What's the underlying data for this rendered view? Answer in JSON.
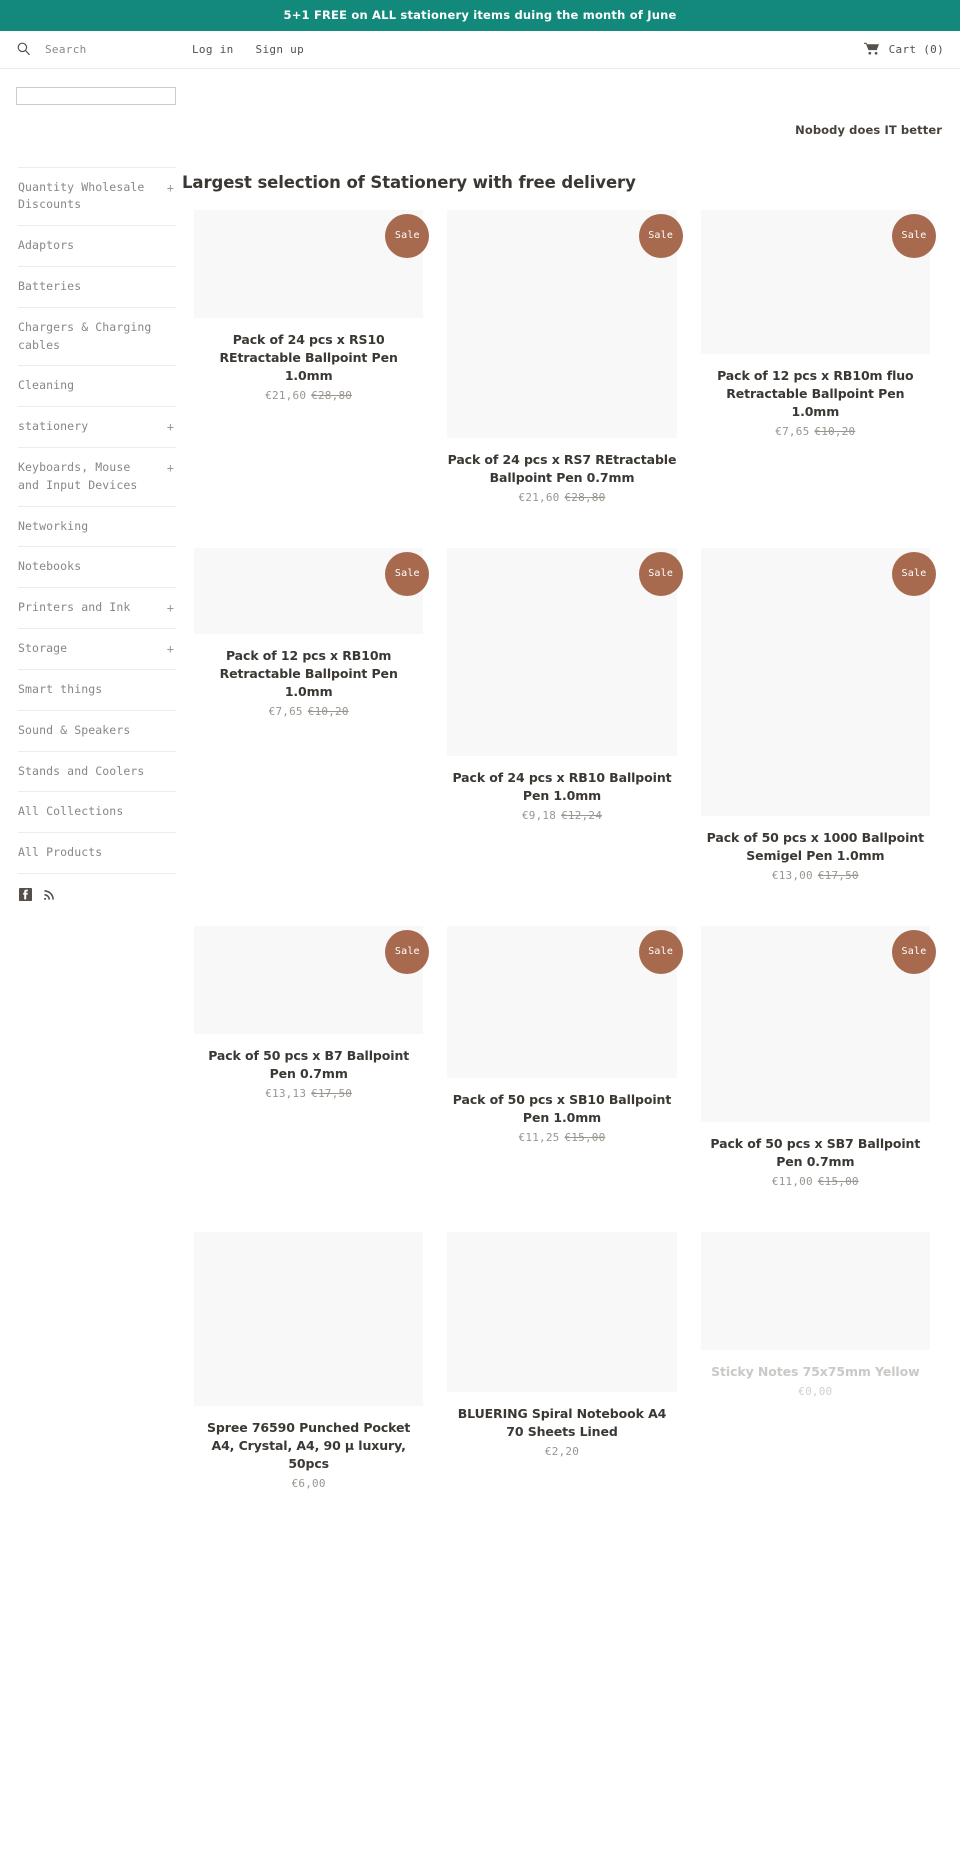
{
  "announcement": {
    "text": "5+1 FREE on ALL stationery items duing the month of June"
  },
  "topbar": {
    "search_icon": "search-icon",
    "search_label": "Search",
    "login_label": "Log in",
    "signup_label": "Sign up",
    "cart_icon": "shopping-cart-icon",
    "cart_label": "Cart (0)"
  },
  "search": {
    "value": "",
    "placeholder": ""
  },
  "tagline": "Nobody does IT better",
  "sidebar": {
    "items": [
      {
        "label": "Quantity Wholesale Discounts",
        "expandable": true,
        "plus": "+"
      },
      {
        "label": "Adaptors",
        "expandable": false,
        "plus": ""
      },
      {
        "label": "Batteries",
        "expandable": false,
        "plus": ""
      },
      {
        "label": "Chargers & Charging cables",
        "expandable": false,
        "plus": ""
      },
      {
        "label": "Cleaning",
        "expandable": false,
        "plus": ""
      },
      {
        "label": "stationery",
        "expandable": true,
        "plus": "+"
      },
      {
        "label": "Keyboards, Mouse and Input Devices",
        "expandable": true,
        "plus": "+"
      },
      {
        "label": "Networking",
        "expandable": false,
        "plus": ""
      },
      {
        "label": "Notebooks",
        "expandable": false,
        "plus": ""
      },
      {
        "label": "Printers and Ink",
        "expandable": true,
        "plus": "+"
      },
      {
        "label": "Storage",
        "expandable": true,
        "plus": "+"
      },
      {
        "label": "Smart things",
        "expandable": false,
        "plus": ""
      },
      {
        "label": "Sound & Speakers",
        "expandable": false,
        "plus": ""
      },
      {
        "label": "Stands and Coolers",
        "expandable": false,
        "plus": ""
      },
      {
        "label": "All Collections",
        "expandable": false,
        "plus": ""
      },
      {
        "label": "All Products",
        "expandable": false,
        "plus": ""
      }
    ],
    "social": [
      {
        "icon": "facebook-icon"
      },
      {
        "icon": "rss-icon"
      }
    ]
  },
  "main": {
    "page_title": "Largest selection of Stationery with free delivery",
    "sale_badge_label": "Sale",
    "products": [
      {
        "title": "Pack of 24 pcs x RS10 REtractable Ballpoint Pen 1.0mm",
        "price": "€21,60",
        "compare_price": "€28,80",
        "on_sale": true,
        "thumb_height": 108,
        "faded": false
      },
      {
        "title": "Pack of 24 pcs x RS7 REtractable Ballpoint Pen 0.7mm",
        "price": "€21,60",
        "compare_price": "€28,80",
        "on_sale": true,
        "thumb_height": 228,
        "faded": false
      },
      {
        "title": "Pack of 12 pcs x RB10m fluo Retractable Ballpoint Pen 1.0mm",
        "price": "€7,65",
        "compare_price": "€10,20",
        "on_sale": true,
        "thumb_height": 144,
        "faded": false
      },
      {
        "title": "Pack of 12 pcs x RB10m Retractable Ballpoint Pen 1.0mm",
        "price": "€7,65",
        "compare_price": "€10,20",
        "on_sale": true,
        "thumb_height": 86,
        "faded": false
      },
      {
        "title": "Pack of 24 pcs x RB10 Ballpoint Pen 1.0mm",
        "price": "€9,18",
        "compare_price": "€12,24",
        "on_sale": true,
        "thumb_height": 208,
        "faded": false
      },
      {
        "title": "Pack of 50 pcs x 1000 Ballpoint Semigel Pen 1.0mm",
        "price": "€13,00",
        "compare_price": "€17,50",
        "on_sale": true,
        "thumb_height": 268,
        "faded": false
      },
      {
        "title": "Pack of 50 pcs x B7 Ballpoint Pen 0.7mm",
        "price": "€13,13",
        "compare_price": "€17,50",
        "on_sale": true,
        "thumb_height": 108,
        "faded": false
      },
      {
        "title": "Pack of 50 pcs x SB10 Ballpoint Pen 1.0mm",
        "price": "€11,25",
        "compare_price": "€15,00",
        "on_sale": true,
        "thumb_height": 152,
        "faded": false
      },
      {
        "title": "Pack of 50 pcs x SB7 Ballpoint Pen 0.7mm",
        "price": "€11,00",
        "compare_price": "€15,00",
        "on_sale": true,
        "thumb_height": 196,
        "faded": false
      },
      {
        "title": "Spree 76590 Punched Pocket A4, Crystal, A4, 90 µ luxury, 50pcs",
        "price": "€6,00",
        "compare_price": "",
        "on_sale": false,
        "thumb_height": 174,
        "faded": false
      },
      {
        "title": "BLUERING Spiral Notebook A4 70 Sheets Lined",
        "price": "€2,20",
        "compare_price": "",
        "on_sale": false,
        "thumb_height": 160,
        "faded": false
      },
      {
        "title": "Sticky Notes 75x75mm Yellow",
        "price": "€0,00",
        "compare_price": "",
        "on_sale": false,
        "thumb_height": 118,
        "faded": true
      }
    ]
  },
  "colors": {
    "announcement_bg": "#12897b",
    "sale_badge_bg": "#a86a4f",
    "text": "#3b3733",
    "muted": "#9b958f",
    "thumb_bg": "#f8f8f8"
  }
}
